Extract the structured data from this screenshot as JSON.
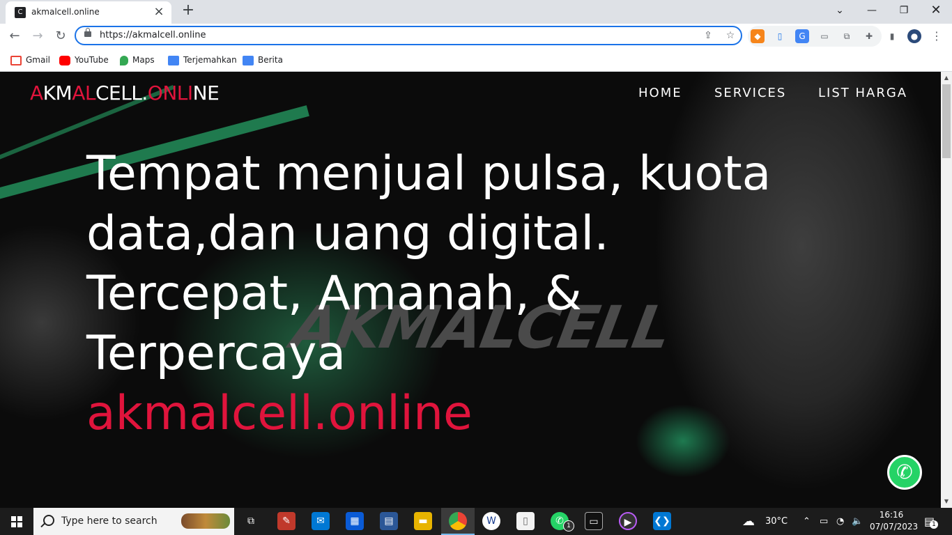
{
  "browser": {
    "tab_title": "akmalcell.online",
    "tab_favicon": "C",
    "url": "https://akmalcell.online",
    "bookmarks": [
      {
        "label": "Gmail",
        "icon": "gmail-icon",
        "color": "#ea4335"
      },
      {
        "label": "YouTube",
        "icon": "youtube-icon",
        "color": "#ff0000"
      },
      {
        "label": "Maps",
        "icon": "maps-icon",
        "color": "#34a853"
      },
      {
        "label": "Terjemahkan",
        "icon": "translate-icon",
        "color": "#4285f4"
      },
      {
        "label": "Berita",
        "icon": "news-icon",
        "color": "#4285f4"
      }
    ]
  },
  "site": {
    "logo_parts": [
      "A",
      "KM",
      "AL",
      "CELL.",
      "ONLI",
      "NE"
    ],
    "nav": [
      "HOME",
      "SERVICES",
      "LIST HARGA"
    ],
    "hero_lines": [
      "Tempat menjual pulsa, kuota",
      "data,dan uang digital.",
      "Tercepat, Amanah, &",
      "Terpercaya"
    ],
    "hero_accent": "akmalcell.online",
    "watermark": "AKMALCELL",
    "accent_color": "#e0143c"
  },
  "taskbar": {
    "search_placeholder": "Type here to search",
    "weather": "30°C",
    "time": "16:16",
    "date": "07/07/2023",
    "notification_count": "1",
    "whatsapp_badge": "1"
  }
}
